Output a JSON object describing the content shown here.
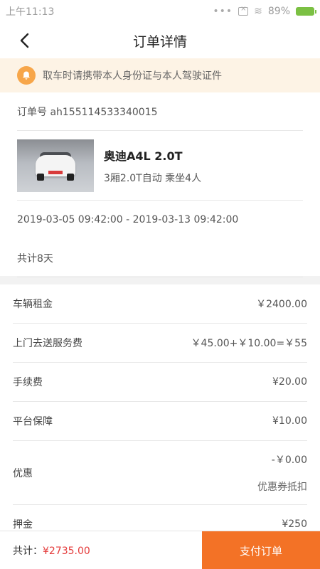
{
  "status_bar": {
    "time": "上午11:13",
    "battery": "89%"
  },
  "header": {
    "title": "订单详情"
  },
  "notice": {
    "text": "取车时请携带本人身份证与本人驾驶证件"
  },
  "order": {
    "order_no": "订单号 ah155114533340015",
    "car_name": "奥迪A4L 2.0T",
    "car_spec": "3厢2.0T自动 乘坐4人",
    "date_range": "2019-03-05 09:42:00 - 2019-03-13 09:42:00",
    "total_days": "共计8天"
  },
  "fees": [
    {
      "label": "车辆租金",
      "value": "￥2400.00"
    },
    {
      "label": "上门去送服务费",
      "value": "￥45.00+￥10.00=￥55"
    },
    {
      "label": "手续费",
      "value": "¥20.00"
    },
    {
      "label": "平台保障",
      "value": "¥10.00"
    },
    {
      "label": "优惠",
      "value": "-￥0.00",
      "sub": "优惠券抵扣"
    },
    {
      "label": "押金",
      "value": "¥250"
    }
  ],
  "footer": {
    "total_label": "共计：",
    "total_value": "¥2735.00",
    "pay_label": "支付订单"
  },
  "colors": {
    "accent": "#f37226",
    "price_red": "#e43b3b",
    "notice_bg": "#fdf3e5"
  }
}
